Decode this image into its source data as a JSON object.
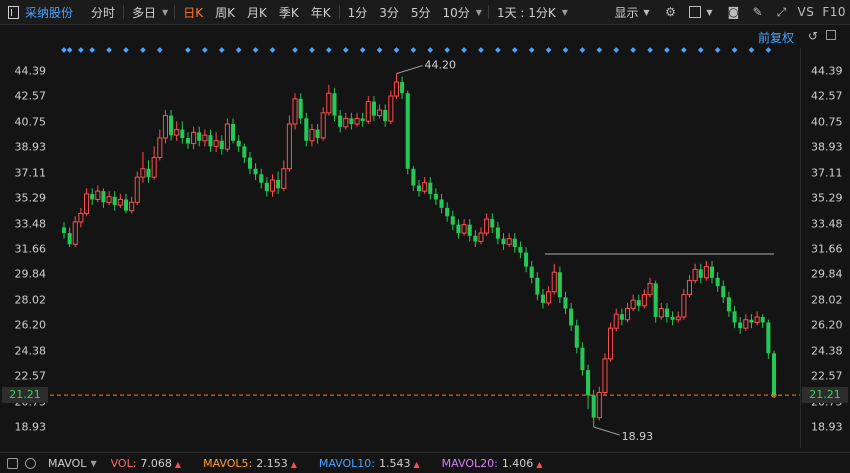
{
  "toolbar": {
    "symbol": "采纳股份",
    "periods": [
      {
        "label": "分时",
        "active": false
      },
      {
        "label": "多日",
        "active": false,
        "dropdown": true
      },
      {
        "label": "日K",
        "active": true
      },
      {
        "label": "周K",
        "active": false
      },
      {
        "label": "月K",
        "active": false
      },
      {
        "label": "季K",
        "active": false
      },
      {
        "label": "年K",
        "active": false
      },
      {
        "label": "1分",
        "active": false
      },
      {
        "label": "3分",
        "active": false
      },
      {
        "label": "5分",
        "active": false
      },
      {
        "label": "10分",
        "active": false,
        "dropdown": true
      },
      {
        "label": "1天 : 1分K",
        "active": false,
        "dropdown": true
      }
    ],
    "display_label": "显示",
    "vs_label": "VS",
    "f10_label": "F10"
  },
  "subbar": {
    "fuquan_label": "前复权"
  },
  "axis": {
    "ticks": [
      "44.39",
      "42.57",
      "40.75",
      "38.93",
      "37.11",
      "35.29",
      "33.48",
      "31.66",
      "29.84",
      "28.02",
      "26.20",
      "24.38",
      "22.57",
      "20.75",
      "18.93"
    ],
    "current_price": "21.21"
  },
  "annotations": {
    "high": "44.20",
    "low": "18.93"
  },
  "bottom": {
    "indicator": "MAVOL",
    "values": [
      {
        "label": "VOL:",
        "value": "7.068",
        "color": "#ff6a6a"
      },
      {
        "label": "MAVOL5:",
        "value": "2.153",
        "color": "#ff9d2e"
      },
      {
        "label": "MAVOL10:",
        "value": "1.543",
        "color": "#4aa3ff"
      },
      {
        "label": "MAVOL20:",
        "value": "1.406",
        "color": "#d67cff"
      }
    ]
  },
  "colors": {
    "up": "#ff4d4d",
    "down": "#25c757",
    "marker": "#4aa3ff",
    "dashed": "#ff7a2a",
    "resistance": "#7a7a7a"
  },
  "chart_data": {
    "type": "candlestick",
    "ylim": [
      18.0,
      45.5
    ],
    "high": 44.2,
    "low": 18.93,
    "current": 21.21,
    "resistance_level": 31.3,
    "candles": [
      [
        33.2,
        32.8,
        33.6,
        32.4
      ],
      [
        32.8,
        32.0,
        33.2,
        31.8
      ],
      [
        32.0,
        33.6,
        34.0,
        31.8
      ],
      [
        33.6,
        34.2,
        34.6,
        33.2
      ],
      [
        34.2,
        35.6,
        36.0,
        34.0
      ],
      [
        35.6,
        35.2,
        36.0,
        34.8
      ],
      [
        35.2,
        35.8,
        36.2,
        35.0
      ],
      [
        35.8,
        35.0,
        36.0,
        34.6
      ],
      [
        35.0,
        35.4,
        35.8,
        34.8
      ],
      [
        35.4,
        34.8,
        35.8,
        34.4
      ],
      [
        34.8,
        35.2,
        35.6,
        34.6
      ],
      [
        35.2,
        34.4,
        35.6,
        34.2
      ],
      [
        34.4,
        35.0,
        35.4,
        34.2
      ],
      [
        35.0,
        36.8,
        37.2,
        34.8
      ],
      [
        36.8,
        37.4,
        38.6,
        36.4
      ],
      [
        37.4,
        36.8,
        38.0,
        36.4
      ],
      [
        36.8,
        38.2,
        39.0,
        36.6
      ],
      [
        38.2,
        39.6,
        40.2,
        38.0
      ],
      [
        39.6,
        41.2,
        41.6,
        39.2
      ],
      [
        41.2,
        39.8,
        41.6,
        39.4
      ],
      [
        39.8,
        40.2,
        40.8,
        39.4
      ],
      [
        40.2,
        39.6,
        40.8,
        39.2
      ],
      [
        39.6,
        39.2,
        40.0,
        38.8
      ],
      [
        39.2,
        40.0,
        40.4,
        38.8
      ],
      [
        40.0,
        39.4,
        40.4,
        39.0
      ],
      [
        39.4,
        39.8,
        40.2,
        39.0
      ],
      [
        39.8,
        39.0,
        40.2,
        38.6
      ],
      [
        39.0,
        39.4,
        40.0,
        38.6
      ],
      [
        39.4,
        38.8,
        39.8,
        38.4
      ],
      [
        38.8,
        40.6,
        41.0,
        38.6
      ],
      [
        40.6,
        39.4,
        41.0,
        39.2
      ],
      [
        39.4,
        39.0,
        39.8,
        38.6
      ],
      [
        39.0,
        38.2,
        39.2,
        37.8
      ],
      [
        38.2,
        37.4,
        38.6,
        37.0
      ],
      [
        37.4,
        37.0,
        37.8,
        36.6
      ],
      [
        37.0,
        36.4,
        37.4,
        36.0
      ],
      [
        36.4,
        35.8,
        36.8,
        35.4
      ],
      [
        35.8,
        36.6,
        37.0,
        35.4
      ],
      [
        36.6,
        36.0,
        37.2,
        35.6
      ],
      [
        36.0,
        37.4,
        38.0,
        35.8
      ],
      [
        37.4,
        40.6,
        41.2,
        37.2
      ],
      [
        40.6,
        42.4,
        42.8,
        40.2
      ],
      [
        42.4,
        41.0,
        42.8,
        40.6
      ],
      [
        41.0,
        39.4,
        41.4,
        39.0
      ],
      [
        39.4,
        40.2,
        40.6,
        39.0
      ],
      [
        40.2,
        39.6,
        40.6,
        39.2
      ],
      [
        39.6,
        41.4,
        41.8,
        39.4
      ],
      [
        41.4,
        42.8,
        43.4,
        41.2
      ],
      [
        42.8,
        41.2,
        43.2,
        40.8
      ],
      [
        41.2,
        40.4,
        41.6,
        40.0
      ],
      [
        40.4,
        41.0,
        41.4,
        40.2
      ],
      [
        41.0,
        40.6,
        41.4,
        40.2
      ],
      [
        40.6,
        41.0,
        41.4,
        40.4
      ],
      [
        41.0,
        40.8,
        41.4,
        40.4
      ],
      [
        40.8,
        42.2,
        42.6,
        40.6
      ],
      [
        42.2,
        41.2,
        42.6,
        40.8
      ],
      [
        41.2,
        41.6,
        42.0,
        41.0
      ],
      [
        41.6,
        40.8,
        42.0,
        40.4
      ],
      [
        40.8,
        42.6,
        43.0,
        40.6
      ],
      [
        42.6,
        43.6,
        44.2,
        42.4
      ],
      [
        43.6,
        42.8,
        44.0,
        42.4
      ],
      [
        42.8,
        37.4,
        43.0,
        37.0
      ],
      [
        37.4,
        36.2,
        37.6,
        35.8
      ],
      [
        36.2,
        35.8,
        36.6,
        35.4
      ],
      [
        35.8,
        36.4,
        36.8,
        35.6
      ],
      [
        36.4,
        35.6,
        36.8,
        35.2
      ],
      [
        35.6,
        35.2,
        36.0,
        34.8
      ],
      [
        35.2,
        34.6,
        35.6,
        34.2
      ],
      [
        34.6,
        34.0,
        35.0,
        33.6
      ],
      [
        34.0,
        33.4,
        34.4,
        33.0
      ],
      [
        33.4,
        32.8,
        33.8,
        32.4
      ],
      [
        32.8,
        33.4,
        33.8,
        32.6
      ],
      [
        33.4,
        32.6,
        33.8,
        32.2
      ],
      [
        32.6,
        32.2,
        33.0,
        31.8
      ],
      [
        32.2,
        32.8,
        33.2,
        32.0
      ],
      [
        32.8,
        33.8,
        34.2,
        32.6
      ],
      [
        33.8,
        33.2,
        34.2,
        32.8
      ],
      [
        33.2,
        32.4,
        33.6,
        32.0
      ],
      [
        32.4,
        32.0,
        32.8,
        31.6
      ],
      [
        32.0,
        32.4,
        32.8,
        31.8
      ],
      [
        32.4,
        31.8,
        32.8,
        31.4
      ],
      [
        31.8,
        31.4,
        32.2,
        31.0
      ],
      [
        31.4,
        30.4,
        31.8,
        30.0
      ],
      [
        30.4,
        29.6,
        30.8,
        29.2
      ],
      [
        29.6,
        28.4,
        30.0,
        28.0
      ],
      [
        28.4,
        27.8,
        28.8,
        27.4
      ],
      [
        27.8,
        28.6,
        29.0,
        27.6
      ],
      [
        28.6,
        30.0,
        30.6,
        28.4
      ],
      [
        30.0,
        28.2,
        30.4,
        27.8
      ],
      [
        28.2,
        27.4,
        28.6,
        27.0
      ],
      [
        27.4,
        26.2,
        27.8,
        25.8
      ],
      [
        26.2,
        24.6,
        26.6,
        24.2
      ],
      [
        24.6,
        23.0,
        25.0,
        22.6
      ],
      [
        23.0,
        21.2,
        23.4,
        20.2
      ],
      [
        21.2,
        19.6,
        21.6,
        18.93
      ],
      [
        19.6,
        21.4,
        21.8,
        19.4
      ],
      [
        21.4,
        23.8,
        24.2,
        21.2
      ],
      [
        23.8,
        26.0,
        26.4,
        23.6
      ],
      [
        26.0,
        27.0,
        27.4,
        25.8
      ],
      [
        27.0,
        26.6,
        27.4,
        26.2
      ],
      [
        26.6,
        27.4,
        27.8,
        26.4
      ],
      [
        27.4,
        28.0,
        28.4,
        27.2
      ],
      [
        28.0,
        27.6,
        28.4,
        27.2
      ],
      [
        27.6,
        28.4,
        28.8,
        27.4
      ],
      [
        28.4,
        29.2,
        29.6,
        28.2
      ],
      [
        29.2,
        26.8,
        29.4,
        26.4
      ],
      [
        26.8,
        27.4,
        27.8,
        26.6
      ],
      [
        27.4,
        26.8,
        27.8,
        26.4
      ],
      [
        26.8,
        26.6,
        27.2,
        26.2
      ],
      [
        26.6,
        26.8,
        27.2,
        26.4
      ],
      [
        26.8,
        28.4,
        28.8,
        26.6
      ],
      [
        28.4,
        29.4,
        29.8,
        28.2
      ],
      [
        29.4,
        30.2,
        30.6,
        29.2
      ],
      [
        30.2,
        29.6,
        30.6,
        29.2
      ],
      [
        29.6,
        30.4,
        30.8,
        29.4
      ],
      [
        30.4,
        29.6,
        30.8,
        29.2
      ],
      [
        29.6,
        29.0,
        30.0,
        28.6
      ],
      [
        29.0,
        28.2,
        29.4,
        27.8
      ],
      [
        28.2,
        27.2,
        28.6,
        26.8
      ],
      [
        27.2,
        26.4,
        27.6,
        26.0
      ],
      [
        26.4,
        26.0,
        26.8,
        25.6
      ],
      [
        26.0,
        26.6,
        27.0,
        25.8
      ],
      [
        26.6,
        26.4,
        27.0,
        26.0
      ],
      [
        26.4,
        26.8,
        27.2,
        26.2
      ],
      [
        26.8,
        26.4,
        27.0,
        26.0
      ],
      [
        26.4,
        24.2,
        26.6,
        23.8
      ],
      [
        24.2,
        21.21,
        24.4,
        21.0
      ]
    ],
    "marker_indices": [
      0,
      1,
      3,
      5,
      8,
      11,
      14,
      17,
      22,
      25,
      28,
      31,
      34,
      37,
      41,
      44,
      47,
      50,
      53,
      56,
      59,
      62,
      65,
      68,
      71,
      74,
      77,
      80,
      83,
      86,
      89,
      92,
      95,
      98,
      101,
      104,
      107,
      110,
      113,
      116,
      119,
      122,
      125
    ]
  }
}
